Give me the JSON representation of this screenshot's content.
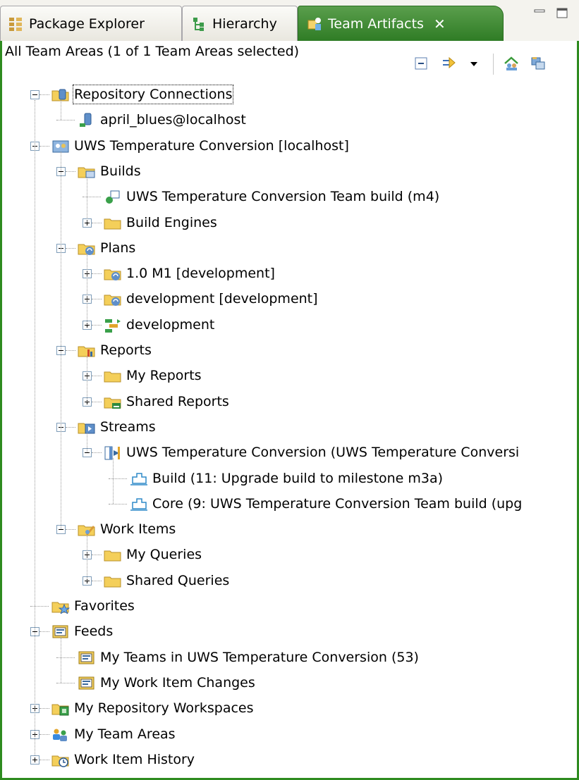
{
  "tabs": [
    {
      "label": "Package Explorer",
      "icon": "package-explorer-icon"
    },
    {
      "label": "Hierarchy",
      "icon": "hierarchy-icon"
    },
    {
      "label": "Team Artifacts",
      "icon": "team-artifacts-icon",
      "active": true
    }
  ],
  "view": {
    "title": "All Team Areas (1 of 1 Team Areas selected)"
  },
  "tree": [
    {
      "label": "Repository Connections",
      "icon": "repository-connections-icon"
    },
    {
      "label": "april_blues@localhost",
      "icon": "repository-connection-icon"
    },
    {
      "label": "UWS Temperature Conversion [localhost]",
      "icon": "project-area-icon"
    },
    {
      "label": "Builds",
      "icon": "builds-folder-icon"
    },
    {
      "label": "UWS Temperature Conversion Team build (m4)",
      "icon": "build-definition-icon"
    },
    {
      "label": "Build Engines",
      "icon": "folder-icon"
    },
    {
      "label": "Plans",
      "icon": "plans-folder-icon"
    },
    {
      "label": "1.0 M1 [development]",
      "icon": "iteration-plans-icon"
    },
    {
      "label": "development [development]",
      "icon": "iteration-plans-icon"
    },
    {
      "label": "development",
      "icon": "timeline-icon"
    },
    {
      "label": "Reports",
      "icon": "reports-folder-icon"
    },
    {
      "label": "My Reports",
      "icon": "folder-icon"
    },
    {
      "label": "Shared Reports",
      "icon": "shared-reports-folder-icon"
    },
    {
      "label": "Streams",
      "icon": "streams-folder-icon"
    },
    {
      "label": "UWS Temperature Conversion (UWS Temperature Conversi",
      "icon": "stream-icon"
    },
    {
      "label": "Build (11: Upgrade build to milestone m3a)",
      "icon": "component-icon"
    },
    {
      "label": "Core (9: UWS Temperature Conversion Team build (upg",
      "icon": "component-icon"
    },
    {
      "label": "Work Items",
      "icon": "work-items-folder-icon"
    },
    {
      "label": "My Queries",
      "icon": "folder-icon"
    },
    {
      "label": "Shared Queries",
      "icon": "folder-icon"
    },
    {
      "label": "Favorites",
      "icon": "favorites-folder-icon"
    },
    {
      "label": "Feeds",
      "icon": "feeds-icon"
    },
    {
      "label": "My Teams in UWS Temperature Conversion (53)",
      "icon": "feed-icon"
    },
    {
      "label": "My Work Item Changes",
      "icon": "feed-icon"
    },
    {
      "label": "My Repository Workspaces",
      "icon": "repository-workspaces-icon"
    },
    {
      "label": "My Team Areas",
      "icon": "team-areas-icon"
    },
    {
      "label": "Work Item History",
      "icon": "work-item-history-icon"
    }
  ],
  "toolbar": [
    {
      "icon": "collapse-all-icon"
    },
    {
      "icon": "link-with-editor-icon"
    },
    {
      "icon": "view-menu-dropdown-icon"
    },
    {
      "icon": "select-team-areas-icon"
    },
    {
      "icon": "manage-connections-icon"
    }
  ],
  "colors": {
    "active_tab": "#2f7c25",
    "frame_border": "#2e8b1f",
    "folder_fill": "#f4cf5a"
  }
}
